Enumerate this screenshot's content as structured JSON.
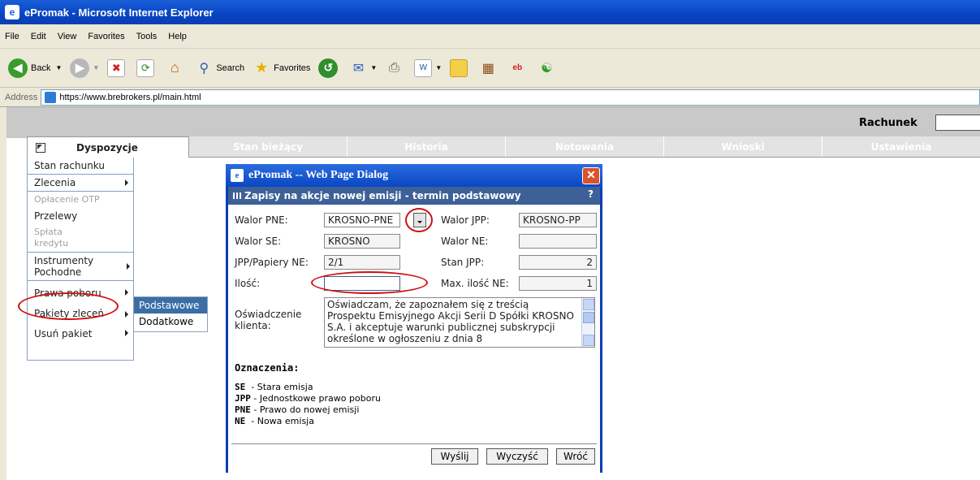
{
  "window": {
    "title": "ePromak - Microsoft Internet Explorer"
  },
  "menu": [
    "File",
    "Edit",
    "View",
    "Favorites",
    "Tools",
    "Help"
  ],
  "toolbar": {
    "back": "Back",
    "search": "Search",
    "favorites": "Favorites"
  },
  "address": {
    "label": "Address",
    "url": "https://www.brebrokers.pl/main.html"
  },
  "header": {
    "account_label": "Rachunek",
    "account_value": ""
  },
  "tabs": [
    "Dyspozycje",
    "Stan bieżący",
    "Historia",
    "Notowania",
    "Wnioski",
    "Ustawienia"
  ],
  "sidebar": {
    "items": [
      {
        "label": "Stan rachunku"
      },
      {
        "label": "Zlecenia"
      },
      {
        "label": "Opłacenie OTP"
      },
      {
        "label": "Przelewy"
      },
      {
        "label": "Spłata kredytu"
      },
      {
        "label": "Instrumenty Pochodne"
      },
      {
        "label": "Prawa poboru"
      },
      {
        "label": "Pakiety zleceń"
      },
      {
        "label": "Usuń pakiet"
      }
    ]
  },
  "submenu": [
    "Podstawowe",
    "Dodatkowe"
  ],
  "dialog": {
    "title": "ePromak -- Web Page Dialog",
    "header": "Zapisy na akcje nowej emisji - termin podstawowy",
    "help": "?",
    "fields": {
      "walor_pne_label": "Walor PNE:",
      "walor_pne_value": "KROSNO-PNE",
      "walor_jpp_label": "Walor JPP:",
      "walor_jpp_value": "KROSNO-PP",
      "walor_se_label": "Walor SE:",
      "walor_se_value": "KROSNO",
      "walor_ne_label": "Walor NE:",
      "walor_ne_value": "",
      "jpp_label": "JPP/Papiery NE:",
      "jpp_value": "2/1",
      "stan_jpp_label": "Stan JPP:",
      "stan_jpp_value": "2",
      "ilosc_label": "Ilość:",
      "ilosc_value": "",
      "max_label": "Max. ilość NE:",
      "max_value": "1",
      "oswiadczenie_label_1": "Oświadczenie",
      "oswiadczenie_label_2": "klienta:",
      "oswiadczenie_text": "Oświadczam, że zapoznałem się z treścią Prospektu Emisyjnego Akcji Serii D Spółki KROSNO S.A. i akceptuje warunki publicznej subskrypcji określone w ogłoszeniu z dnia 8"
    },
    "legend": {
      "title": "Oznaczenia:",
      "rows": [
        {
          "code": "SE",
          "desc": "- Stara emisja"
        },
        {
          "code": "JPP",
          "desc": "- Jednostkowe prawo poboru"
        },
        {
          "code": "PNE",
          "desc": "- Prawo do nowej emisji"
        },
        {
          "code": "NE",
          "desc": "- Nowa emisja"
        }
      ]
    },
    "buttons": {
      "send": "Wyślij",
      "clear": "Wyczyść",
      "back": "Wróć"
    }
  },
  "colors": {
    "accent": "#0a3fb0",
    "dialog_header": "#3d6197",
    "highlight": "#3a6ea5",
    "annotation": "#d01010"
  }
}
